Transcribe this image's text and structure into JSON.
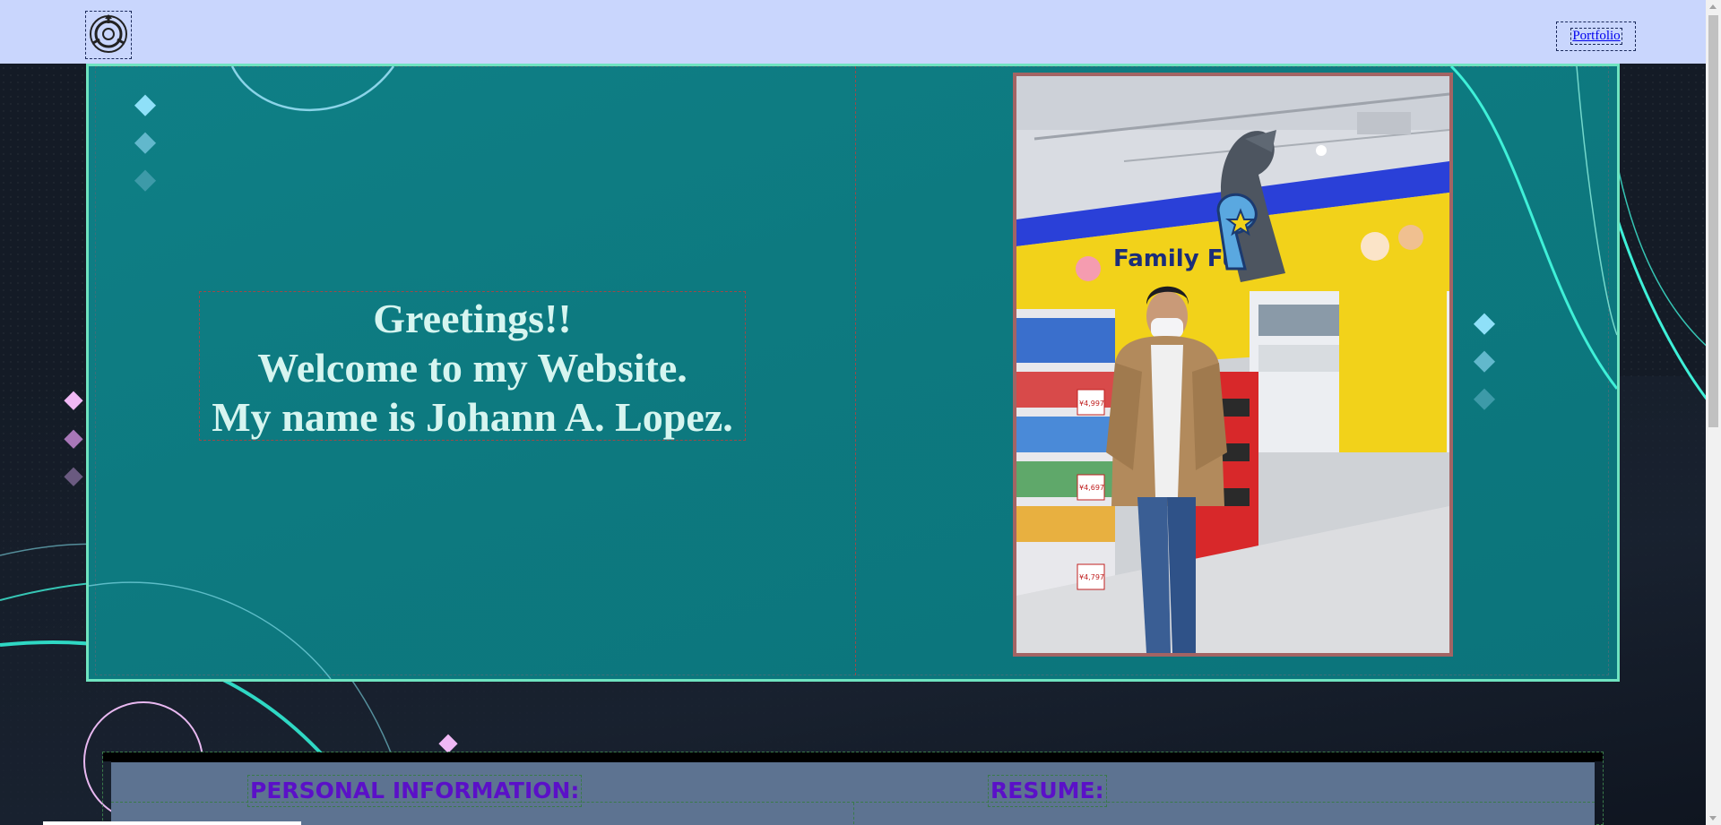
{
  "header": {
    "logo_icon": "scp-foundation-logo-icon",
    "nav": {
      "portfolio_label": "Portfolio"
    }
  },
  "hero": {
    "greeting_lines": [
      "Greetings!!",
      "Welcome to my Website.",
      "My name is Johann A. Lopez."
    ],
    "photo_sign_text": "Family Fun",
    "price_tags": [
      "¥4,997",
      "¥4,697",
      "¥4,797"
    ]
  },
  "sections": {
    "personal_information_title": "PERSONAL INFORMATION:",
    "resume_title": "RESUME:"
  },
  "colors": {
    "header_bg": "#c9d6fd",
    "hero_bg": "#0f7f86",
    "hero_border": "#6fe4c0",
    "greeting_text": "#d6f5f0",
    "section_title": "#5b10c8",
    "link": "#0000ee",
    "accent_cyan": "#3ff0d8",
    "accent_pink": "#f0c8f5"
  }
}
